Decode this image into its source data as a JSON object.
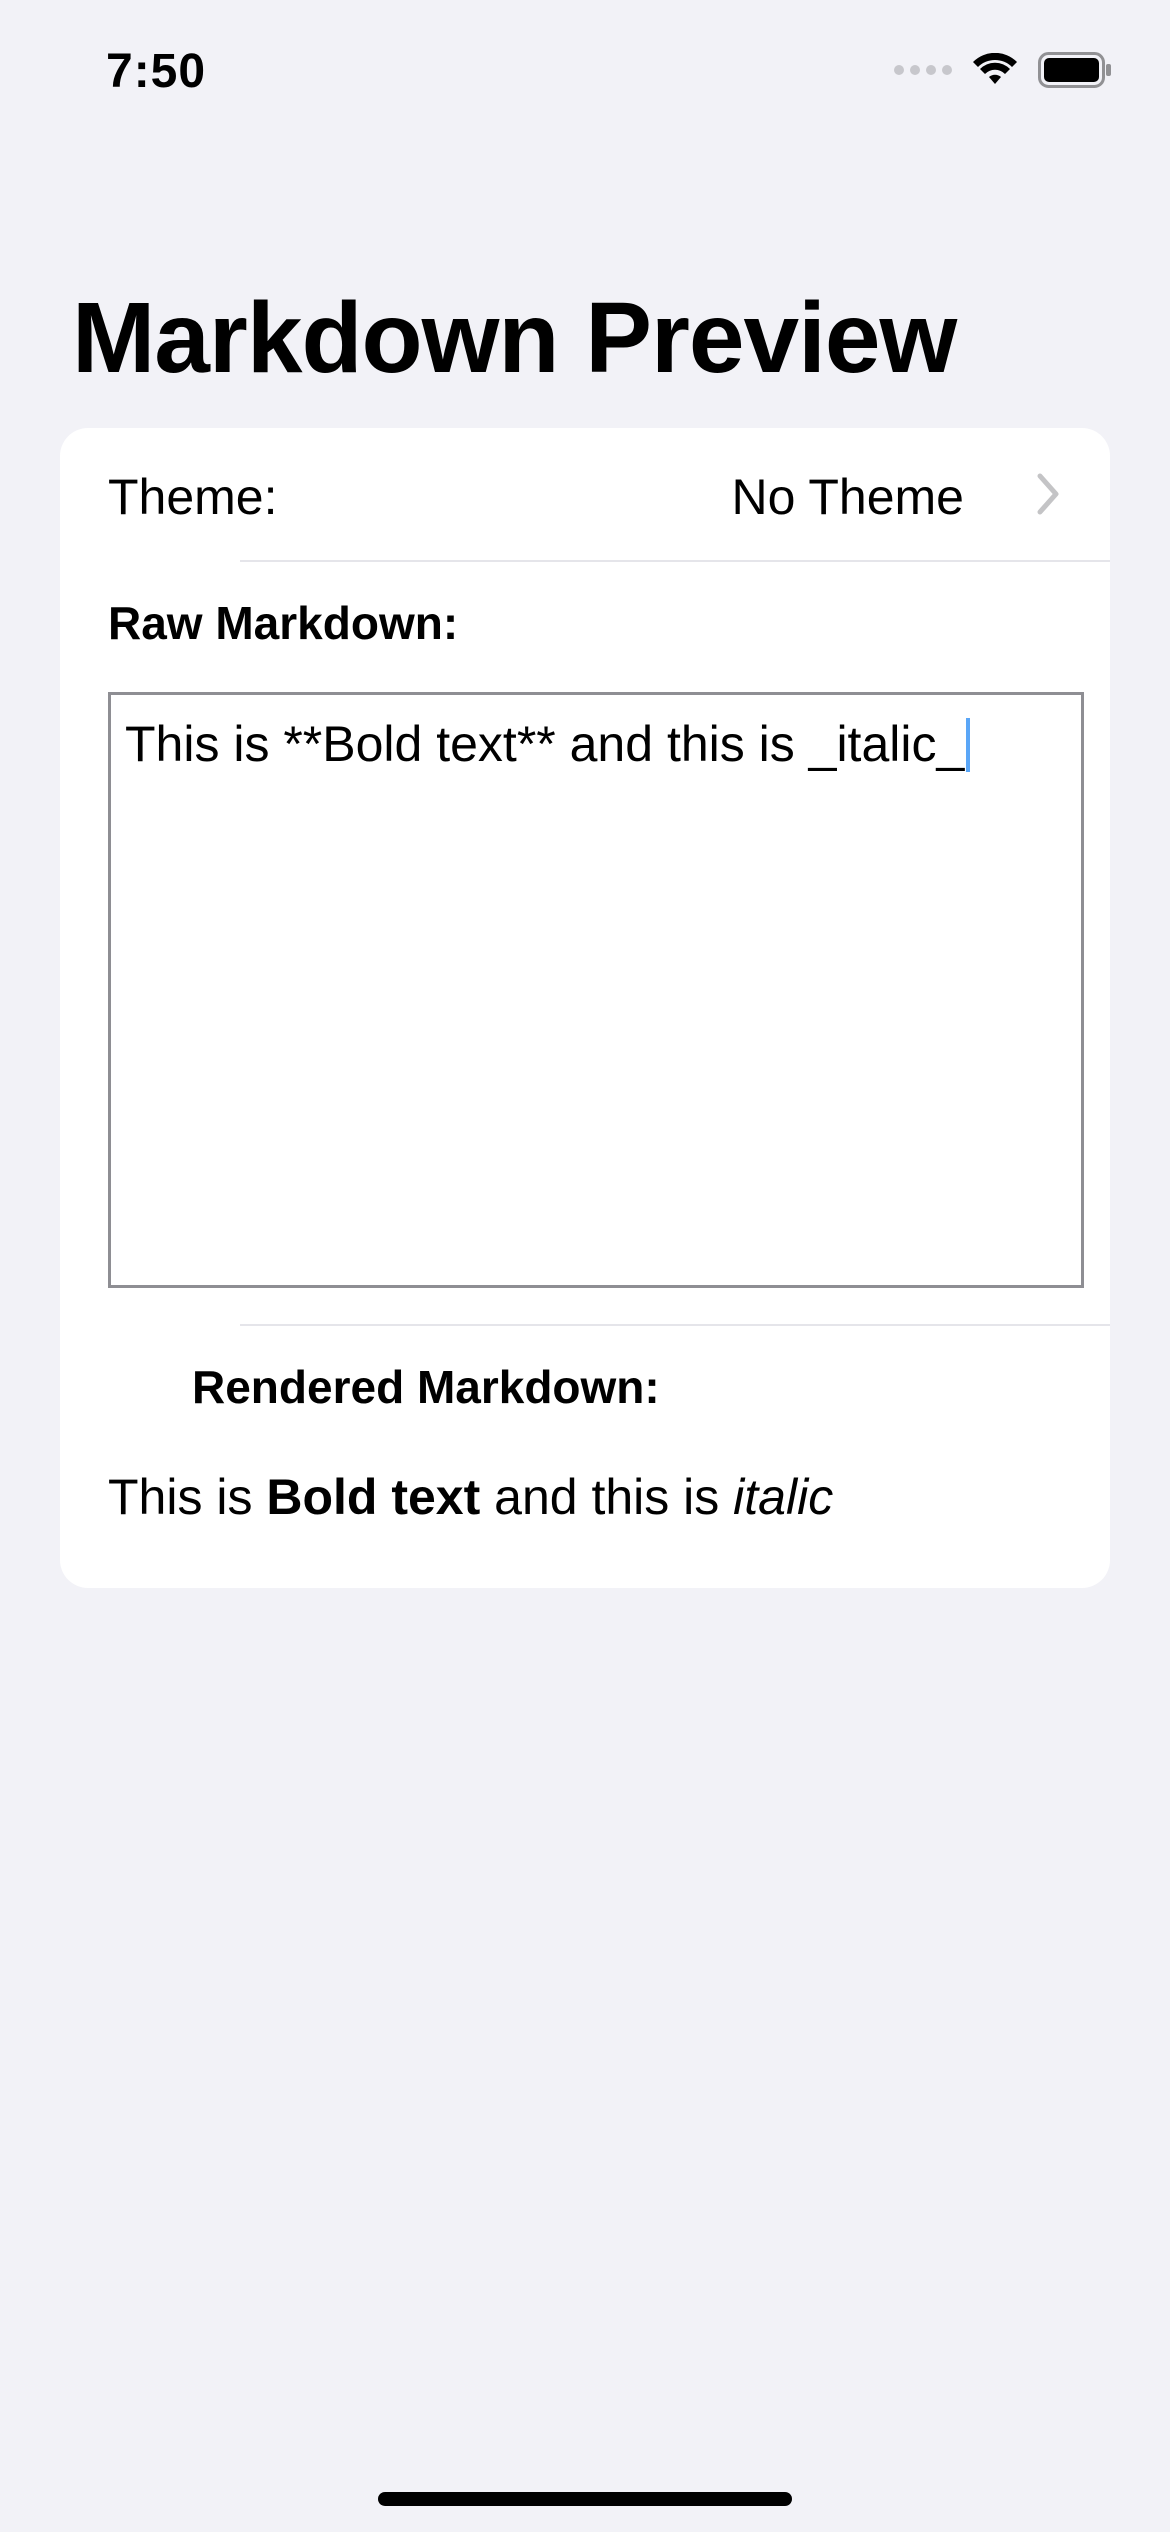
{
  "status_bar": {
    "time": "7:50"
  },
  "header": {
    "title": "Markdown Preview"
  },
  "form": {
    "theme_label": "Theme:",
    "theme_value": "No Theme",
    "raw_label": "Raw Markdown:",
    "raw_value": "This is **Bold text** and this is _italic_",
    "rendered_label": "Rendered Markdown:",
    "rendered": {
      "part1": "This is ",
      "bold": "Bold text",
      "part2": " and this is ",
      "italic": "italic"
    }
  },
  "colors": {
    "background": "#f2f2f7",
    "card": "#ffffff",
    "caret": "#5aa6f7",
    "chevron": "#c4c4c6"
  },
  "icons": {
    "wifi": "wifi-icon",
    "battery": "battery-icon",
    "chevron": "chevron-right-icon"
  }
}
